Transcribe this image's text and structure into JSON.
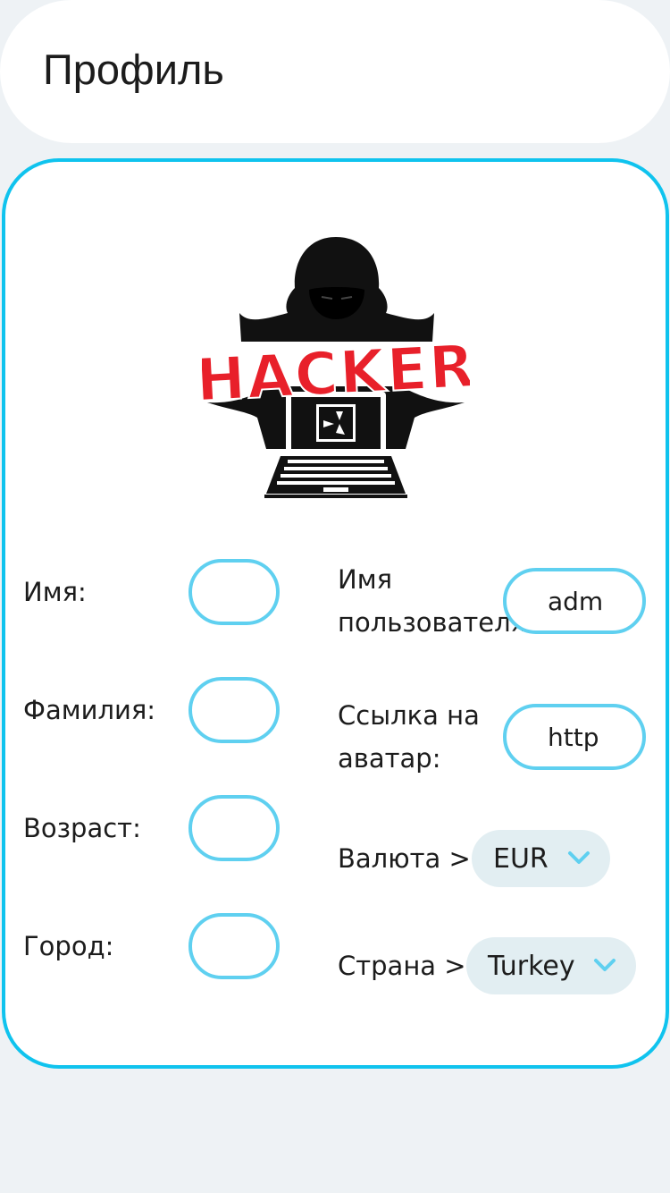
{
  "header": {
    "title": "Профиль"
  },
  "avatar": {
    "logo_text": "HACKER",
    "logo_color": "#e8202a"
  },
  "form": {
    "first_name_label": "Имя:",
    "first_name_value": "",
    "last_name_label": "Фамилия:",
    "last_name_value": "",
    "age_label": "Возраст:",
    "age_value": "",
    "city_label": "Город:",
    "city_value": "",
    "username_label": "Имя пользователя:",
    "username_value": "adm",
    "avatar_link_label": "Ссылка на аватар:",
    "avatar_link_value": "http",
    "currency_label": "Валюта >",
    "currency_value": "EUR",
    "country_label": "Страна >",
    "country_value": "Turkey"
  },
  "colors": {
    "accent": "#0fc3ee",
    "field_border": "#5fd0f0",
    "select_bg": "#e2eef2",
    "page_bg": "#eef2f5"
  }
}
